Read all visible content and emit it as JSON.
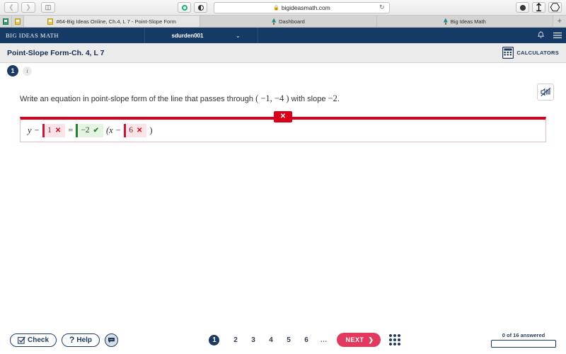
{
  "browser": {
    "back_icon": "chevron-left-icon",
    "forward_icon": "chevron-right-icon",
    "sidebar_icon": "sidebar-icon",
    "extension_icon": "green-circle-icon",
    "reader_icon": "contrast-icon",
    "url": "bigideasmath.com",
    "lock_icon": "lock-icon",
    "reload_icon": "reload-icon",
    "download_icon": "download-icon",
    "share_icon": "share-icon",
    "tabs_icon": "new-tab-icon",
    "new_tab_label": "+",
    "tabs": [
      {
        "label": "#64-Big Ideas Online, Ch.4, L 7 - Point-Slope Form",
        "active": true
      },
      {
        "label": "Dashboard",
        "active": false
      },
      {
        "label": "Big Ideas Math",
        "active": false
      }
    ]
  },
  "appnav": {
    "logo": "BIG IDEAS MATH",
    "username": "sdurden001",
    "caret": "⌄",
    "bell_icon": "bell-icon",
    "menu_icon": "hamburger-menu-icon"
  },
  "assignment": {
    "title": "Point-Slope Form-Ch. 4, L 7",
    "calculators_label": "CALCULATORS",
    "calculator_icon": "calculator-icon",
    "question_number": "1",
    "info_icon": "info-icon",
    "audio_icon": "audio-muted-icon"
  },
  "problem": {
    "prompt_part1": "Write an equation in point-slope form of the line that passes through",
    "point": "( −1,  −4 )",
    "prompt_part2": "with slope",
    "slope": "−2",
    "period": ".",
    "result_badge": "✕",
    "equation": {
      "lhs_var": "y −",
      "field1": {
        "value": "1",
        "mark": "✕",
        "state": "wrong"
      },
      "equals": "=",
      "field2": {
        "value": "−2",
        "mark": "✔",
        "state": "right"
      },
      "open_paren": "(x −",
      "field3": {
        "value": "6",
        "mark": "✕",
        "state": "wrong"
      },
      "close_paren": ")"
    }
  },
  "bottom": {
    "check_label": "Check",
    "check_icon": "checkbox-icon",
    "help_label": "Help",
    "help_icon": "question-mark-icon",
    "chat_icon": "chat-bubble-icon",
    "pages": [
      "1",
      "2",
      "3",
      "4",
      "5",
      "6"
    ],
    "ellipsis": "…",
    "current_page": "1",
    "next_label": "NEXT",
    "next_arrow": "❯",
    "grid_icon": "grid-dots-icon",
    "progress_text": "0 of 16 answered"
  },
  "colors": {
    "nav_blue": "#163a66",
    "accent_red": "#d9001b",
    "next_pink": "#e23a5e",
    "correct_green": "#2f7d32"
  }
}
